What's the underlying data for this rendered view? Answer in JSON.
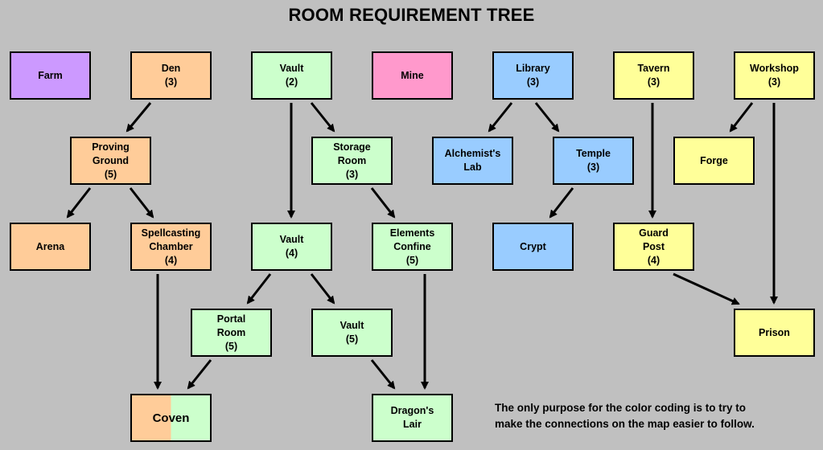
{
  "title": "ROOM REQUIREMENT TREE",
  "note_lines": [
    "The only purpose for the color coding is to try to",
    "make the connections on the map easier to follow."
  ],
  "colors": {
    "purple": "#cc99ff",
    "orange": "#ffcc99",
    "green": "#ccffcc",
    "pink": "#ff99cc",
    "blue": "#99ccff",
    "yellow": "#ffff99"
  },
  "nodes": [
    {
      "id": "farm",
      "label": "Farm",
      "level": null,
      "color": "purple"
    },
    {
      "id": "den",
      "label": "Den",
      "level": 3,
      "color": "orange"
    },
    {
      "id": "vault2",
      "label": "Vault",
      "level": 2,
      "color": "green"
    },
    {
      "id": "mine",
      "label": "Mine",
      "level": null,
      "color": "pink"
    },
    {
      "id": "library",
      "label": "Library",
      "level": 3,
      "color": "blue"
    },
    {
      "id": "tavern",
      "label": "Tavern",
      "level": 3,
      "color": "yellow"
    },
    {
      "id": "workshop",
      "label": "Workshop",
      "level": 3,
      "color": "yellow"
    },
    {
      "id": "proving",
      "label": "Proving\nGround",
      "level": 5,
      "color": "orange"
    },
    {
      "id": "storage",
      "label": "Storage\nRoom",
      "level": 3,
      "color": "green"
    },
    {
      "id": "alchemist",
      "label": "Alchemist's\nLab",
      "level": null,
      "color": "blue"
    },
    {
      "id": "temple",
      "label": "Temple",
      "level": 3,
      "color": "blue"
    },
    {
      "id": "forge",
      "label": "Forge",
      "level": null,
      "color": "yellow"
    },
    {
      "id": "arena",
      "label": "Arena",
      "level": null,
      "color": "orange"
    },
    {
      "id": "spell",
      "label": "Spellcasting\nChamber",
      "level": 4,
      "color": "orange"
    },
    {
      "id": "vault4",
      "label": "Vault",
      "level": 4,
      "color": "green"
    },
    {
      "id": "elements",
      "label": "Elements\nConfine",
      "level": 5,
      "color": "green"
    },
    {
      "id": "crypt",
      "label": "Crypt",
      "level": null,
      "color": "blue"
    },
    {
      "id": "guard",
      "label": "Guard\nPost",
      "level": 4,
      "color": "yellow"
    },
    {
      "id": "portal",
      "label": "Portal\nRoom",
      "level": 5,
      "color": "green"
    },
    {
      "id": "vault5",
      "label": "Vault",
      "level": 5,
      "color": "green"
    },
    {
      "id": "prison",
      "label": "Prison",
      "level": null,
      "color": "yellow"
    },
    {
      "id": "coven",
      "label": "Coven",
      "level": null,
      "color": [
        "orange",
        "green"
      ]
    },
    {
      "id": "dragon",
      "label": "Dragon's\nLair",
      "level": null,
      "color": "green"
    }
  ],
  "edges": [
    [
      "den",
      "proving"
    ],
    [
      "vault2",
      "vault4"
    ],
    [
      "vault2",
      "storage"
    ],
    [
      "library",
      "alchemist"
    ],
    [
      "library",
      "temple"
    ],
    [
      "tavern",
      "guard"
    ],
    [
      "workshop",
      "forge"
    ],
    [
      "workshop",
      "prison"
    ],
    [
      "proving",
      "arena"
    ],
    [
      "proving",
      "spell"
    ],
    [
      "storage",
      "elements"
    ],
    [
      "temple",
      "crypt"
    ],
    [
      "spell",
      "coven"
    ],
    [
      "vault4",
      "portal"
    ],
    [
      "vault4",
      "vault5"
    ],
    [
      "elements",
      "dragon"
    ],
    [
      "guard",
      "prison"
    ],
    [
      "portal",
      "coven"
    ],
    [
      "vault5",
      "dragon"
    ]
  ]
}
